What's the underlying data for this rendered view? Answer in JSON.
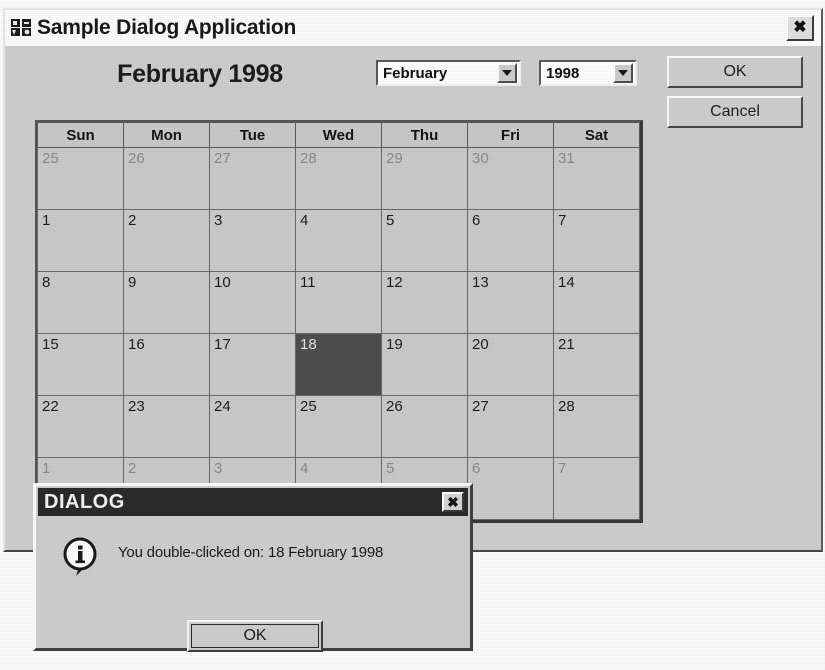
{
  "window": {
    "title": "Sample Dialog Application",
    "icon": "app-icon",
    "close_label": "✖"
  },
  "calendar_panel": {
    "heading": "February 1998",
    "month_select": {
      "value": "February",
      "arrow": "chevron-down-icon"
    },
    "year_select": {
      "value": "1998",
      "arrow": "chevron-down-icon"
    },
    "buttons": {
      "ok": "OK",
      "cancel": "Cancel"
    },
    "day_headers": [
      "Sun",
      "Mon",
      "Tue",
      "Wed",
      "Thu",
      "Fri",
      "Sat"
    ],
    "selected_day": 18,
    "selected_date_text": "18 February 1998",
    "weeks": [
      [
        {
          "d": "25",
          "adjacent": true
        },
        {
          "d": "26",
          "adjacent": true
        },
        {
          "d": "27",
          "adjacent": true
        },
        {
          "d": "28",
          "adjacent": true
        },
        {
          "d": "29",
          "adjacent": true
        },
        {
          "d": "30",
          "adjacent": true
        },
        {
          "d": "31",
          "adjacent": true
        }
      ],
      [
        {
          "d": "1"
        },
        {
          "d": "2"
        },
        {
          "d": "3"
        },
        {
          "d": "4"
        },
        {
          "d": "5"
        },
        {
          "d": "6"
        },
        {
          "d": "7"
        }
      ],
      [
        {
          "d": "8"
        },
        {
          "d": "9"
        },
        {
          "d": "10"
        },
        {
          "d": "11"
        },
        {
          "d": "12"
        },
        {
          "d": "13"
        },
        {
          "d": "14"
        }
      ],
      [
        {
          "d": "15"
        },
        {
          "d": "16"
        },
        {
          "d": "17"
        },
        {
          "d": "18",
          "selected": true
        },
        {
          "d": "19"
        },
        {
          "d": "20"
        },
        {
          "d": "21"
        }
      ],
      [
        {
          "d": "22"
        },
        {
          "d": "23"
        },
        {
          "d": "24"
        },
        {
          "d": "25"
        },
        {
          "d": "26"
        },
        {
          "d": "27"
        },
        {
          "d": "28"
        }
      ],
      [
        {
          "d": "1",
          "adjacent": true
        },
        {
          "d": "2",
          "adjacent": true
        },
        {
          "d": "3",
          "adjacent": true
        },
        {
          "d": "4",
          "adjacent": true
        },
        {
          "d": "5",
          "adjacent": true
        },
        {
          "d": "6",
          "adjacent": true
        },
        {
          "d": "7",
          "adjacent": true
        }
      ]
    ]
  },
  "message_dialog": {
    "title": "DIALOG",
    "close_label": "✖",
    "icon": "info-icon",
    "message": "You double-clicked on: 18 February 1998",
    "ok_label": "OK"
  },
  "colors": {
    "face": "#cfcfcf",
    "titlebar_bg": "#fdfdfd",
    "dialog_titlebar_bg": "#2b2b2b",
    "selection_bg": "#4f4f4f",
    "selection_fg": "#e6e6e6",
    "adjacent_day_fg": "#8a8a8a",
    "text": "#1b1b1b"
  }
}
